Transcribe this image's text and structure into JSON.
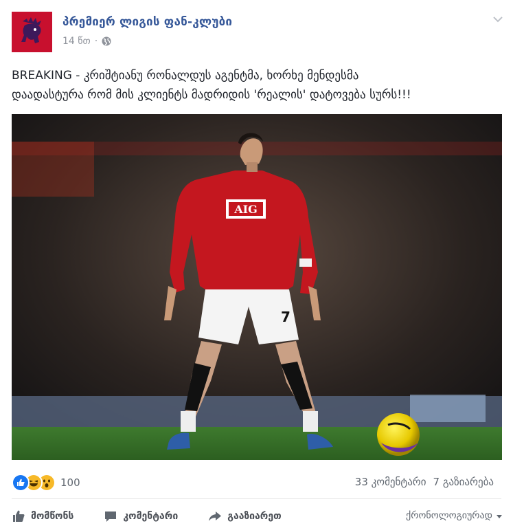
{
  "post": {
    "page_name": "პრემიერ ლიგის ფან-კლუბი",
    "time": "14 წთ",
    "separator": "·",
    "audience_icon": "globe-icon",
    "text_line1": "BREAKING - კრიშტიანუ რონალდუს აგენტმა, ხორხე მენდესმა",
    "text_line2": "დაადასტურა რომ მის კლიენტს მადრიდის 'რეალის' დატოვება სურს!!!",
    "photo": {
      "jersey_sponsor": "AIG",
      "shorts_number": "7"
    }
  },
  "reactions": {
    "icons": [
      "like-icon",
      "haha-icon",
      "wow-icon"
    ],
    "colors": {
      "like": "#1877f2",
      "haha": "#f7b928",
      "wow": "#f7b928"
    },
    "count": "100"
  },
  "stats": {
    "comments": "33 კომენტარი",
    "shares": "7 გაზიარება"
  },
  "actions": {
    "like": "მომწონს",
    "comment": "კომენტარი",
    "share": "გააზიარეთ"
  },
  "sort": {
    "label": "ქრონოლოგიურად"
  },
  "colors": {
    "link": "#365899",
    "meta": "#90949c",
    "avatar_bg": "#c8102e"
  }
}
